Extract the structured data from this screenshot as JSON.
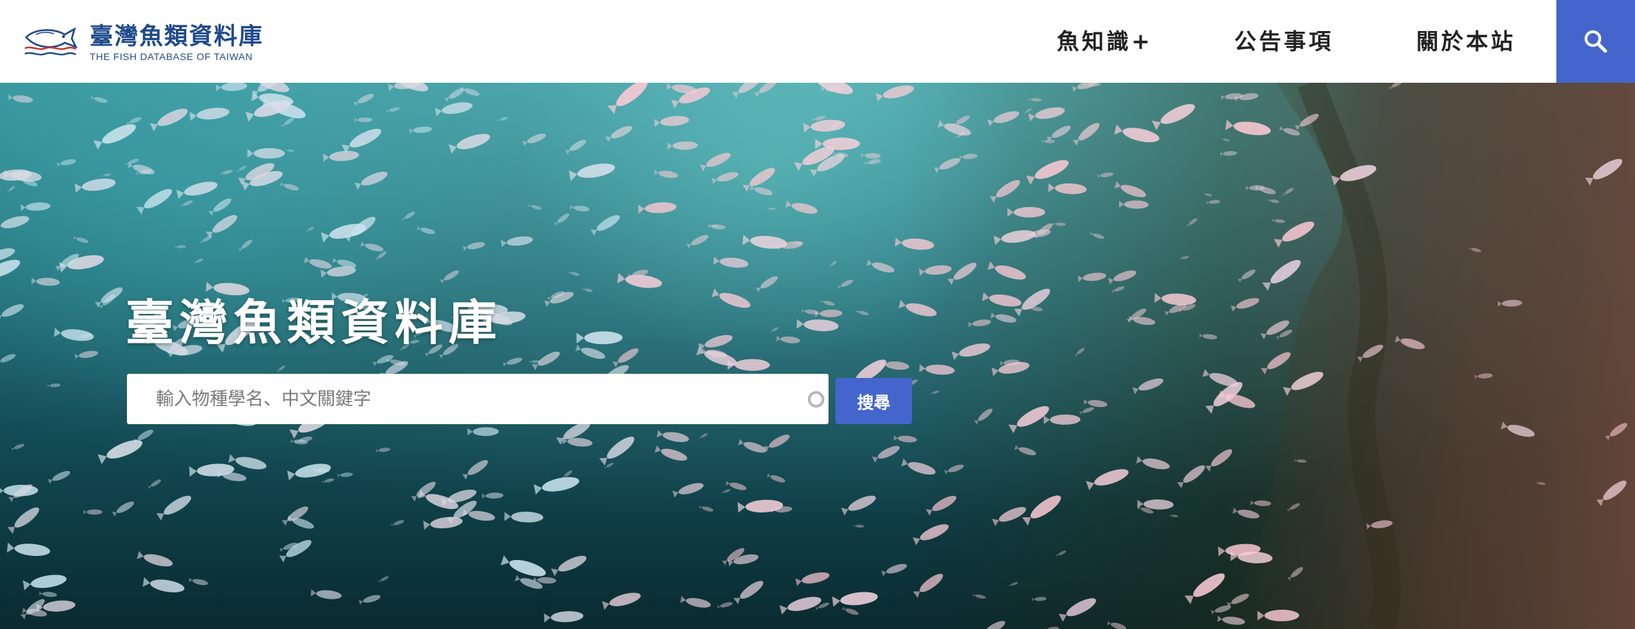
{
  "site": {
    "title": "臺灣魚類資料庫",
    "subtitle": "THE FISH DATABASE OF TAIWAN",
    "logo_icon": "fish-logo-icon"
  },
  "nav": {
    "items": [
      {
        "label": "魚知識+"
      },
      {
        "label": "公告事項"
      },
      {
        "label": "關於本站"
      }
    ],
    "search_icon": "search-icon"
  },
  "hero": {
    "title": "臺灣魚類資料庫",
    "background": "underwater-fish-school-photo",
    "search": {
      "placeholder": "輸入物種學名、中文關鍵字",
      "value": "",
      "button_label": "搜尋",
      "loading_icon": "spinner-icon"
    }
  },
  "colors": {
    "brand": "#1f4a8c",
    "accent": "#4466cc",
    "nav_text": "#222222",
    "hero_text": "#ffffff"
  }
}
